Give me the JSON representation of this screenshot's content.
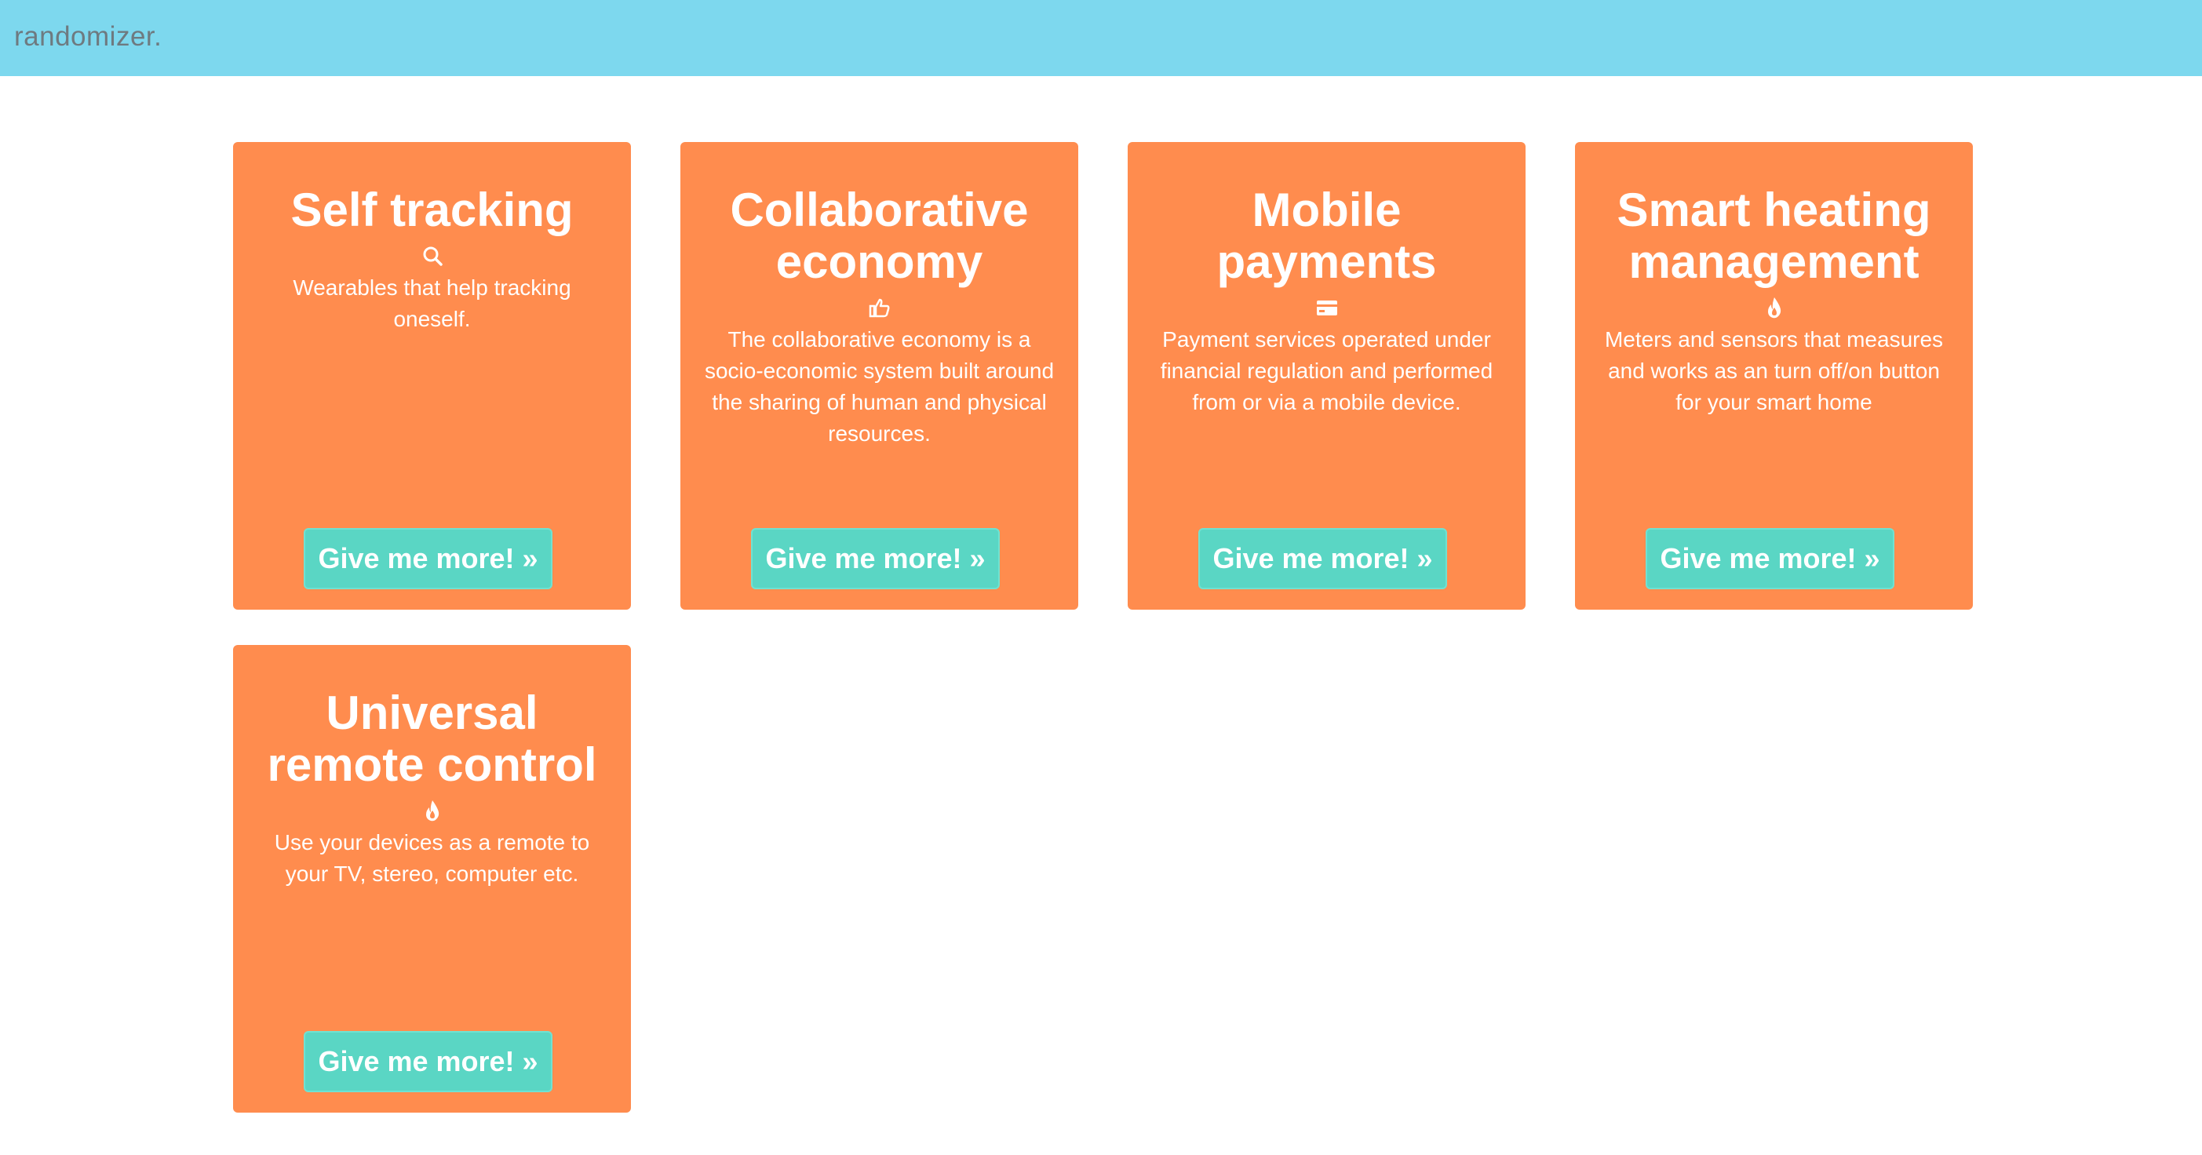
{
  "navbar": {
    "brand": "randomizer."
  },
  "cards": [
    {
      "title": "Self tracking",
      "icon": "search-icon",
      "description": "Wearables that help tracking oneself.",
      "button_label": "Give me more! »"
    },
    {
      "title": "Collaborative economy",
      "icon": "thumbs-up-icon",
      "description": "The collaborative economy is a socio-economic system built around the sharing of human and physical resources.",
      "button_label": "Give me more! »"
    },
    {
      "title": "Mobile payments",
      "icon": "credit-card-icon",
      "description": "Payment services operated under financial regulation and performed from or via a mobile device.",
      "button_label": "Give me more! »"
    },
    {
      "title": "Smart heating management",
      "icon": "flame-icon",
      "description": "Meters and sensors that measures and works as an turn off/on button for your smart home",
      "button_label": "Give me more! »"
    },
    {
      "title": "Universal remote control",
      "icon": "flame-icon",
      "description": "Use your devices as a remote to your TV, stereo, computer etc.",
      "button_label": "Give me more! »"
    }
  ],
  "colors": {
    "navbar": "#7dd8ee",
    "card": "#ff8c4e",
    "button": "#5ad6c4",
    "text": "#ffffff"
  }
}
